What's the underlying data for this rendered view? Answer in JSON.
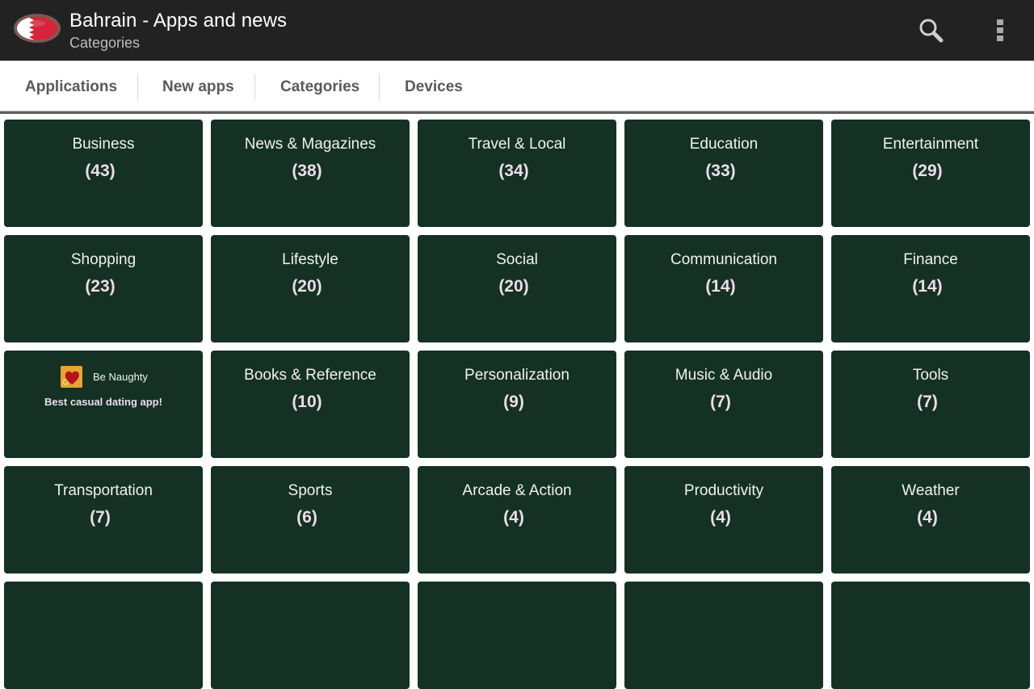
{
  "appbar": {
    "title": "Bahrain - Apps and news",
    "subtitle": "Categories",
    "icons": [
      "bahrain-flag-logo",
      "search-icon",
      "more-vert-icon"
    ]
  },
  "tabs": [
    {
      "label": "Applications"
    },
    {
      "label": "New apps"
    },
    {
      "label": "Categories",
      "selected": true
    },
    {
      "label": "Devices"
    }
  ],
  "colors": {
    "appbar_bg": "#222222",
    "tile_bg": "#143124",
    "tile_text": "#f1f1f1",
    "count_text": "#ecdde8",
    "tab_text": "#5a5a5a"
  },
  "tiles": [
    {
      "name": "Business",
      "count": "(43)"
    },
    {
      "name": "News & Magazines",
      "count": "(38)"
    },
    {
      "name": "Travel & Local",
      "count": "(34)"
    },
    {
      "name": "Education",
      "count": "(33)"
    },
    {
      "name": "Entertainment",
      "count": "(29)"
    },
    {
      "name": "Shopping",
      "count": "(23)"
    },
    {
      "name": "Lifestyle",
      "count": "(20)"
    },
    {
      "name": "Social",
      "count": "(20)"
    },
    {
      "name": "Communication",
      "count": "(14)"
    },
    {
      "name": "Finance",
      "count": "(14)"
    },
    {
      "ad": true,
      "ad_name": "Be Naughty",
      "ad_tagline": "Best casual dating app!",
      "ad_icon": "heart-icon"
    },
    {
      "name": "Books & Reference",
      "count": "(10)"
    },
    {
      "name": "Personalization",
      "count": "(9)"
    },
    {
      "name": "Music & Audio",
      "count": "(7)"
    },
    {
      "name": "Tools",
      "count": "(7)"
    },
    {
      "name": "Transportation",
      "count": "(7)"
    },
    {
      "name": "Sports",
      "count": "(6)"
    },
    {
      "name": "Arcade & Action",
      "count": "(4)"
    },
    {
      "name": "Productivity",
      "count": "(4)"
    },
    {
      "name": "Weather",
      "count": "(4)"
    },
    {
      "name": "",
      "count": ""
    },
    {
      "name": "",
      "count": ""
    },
    {
      "name": "",
      "count": ""
    },
    {
      "name": "",
      "count": ""
    },
    {
      "name": "",
      "count": ""
    }
  ]
}
